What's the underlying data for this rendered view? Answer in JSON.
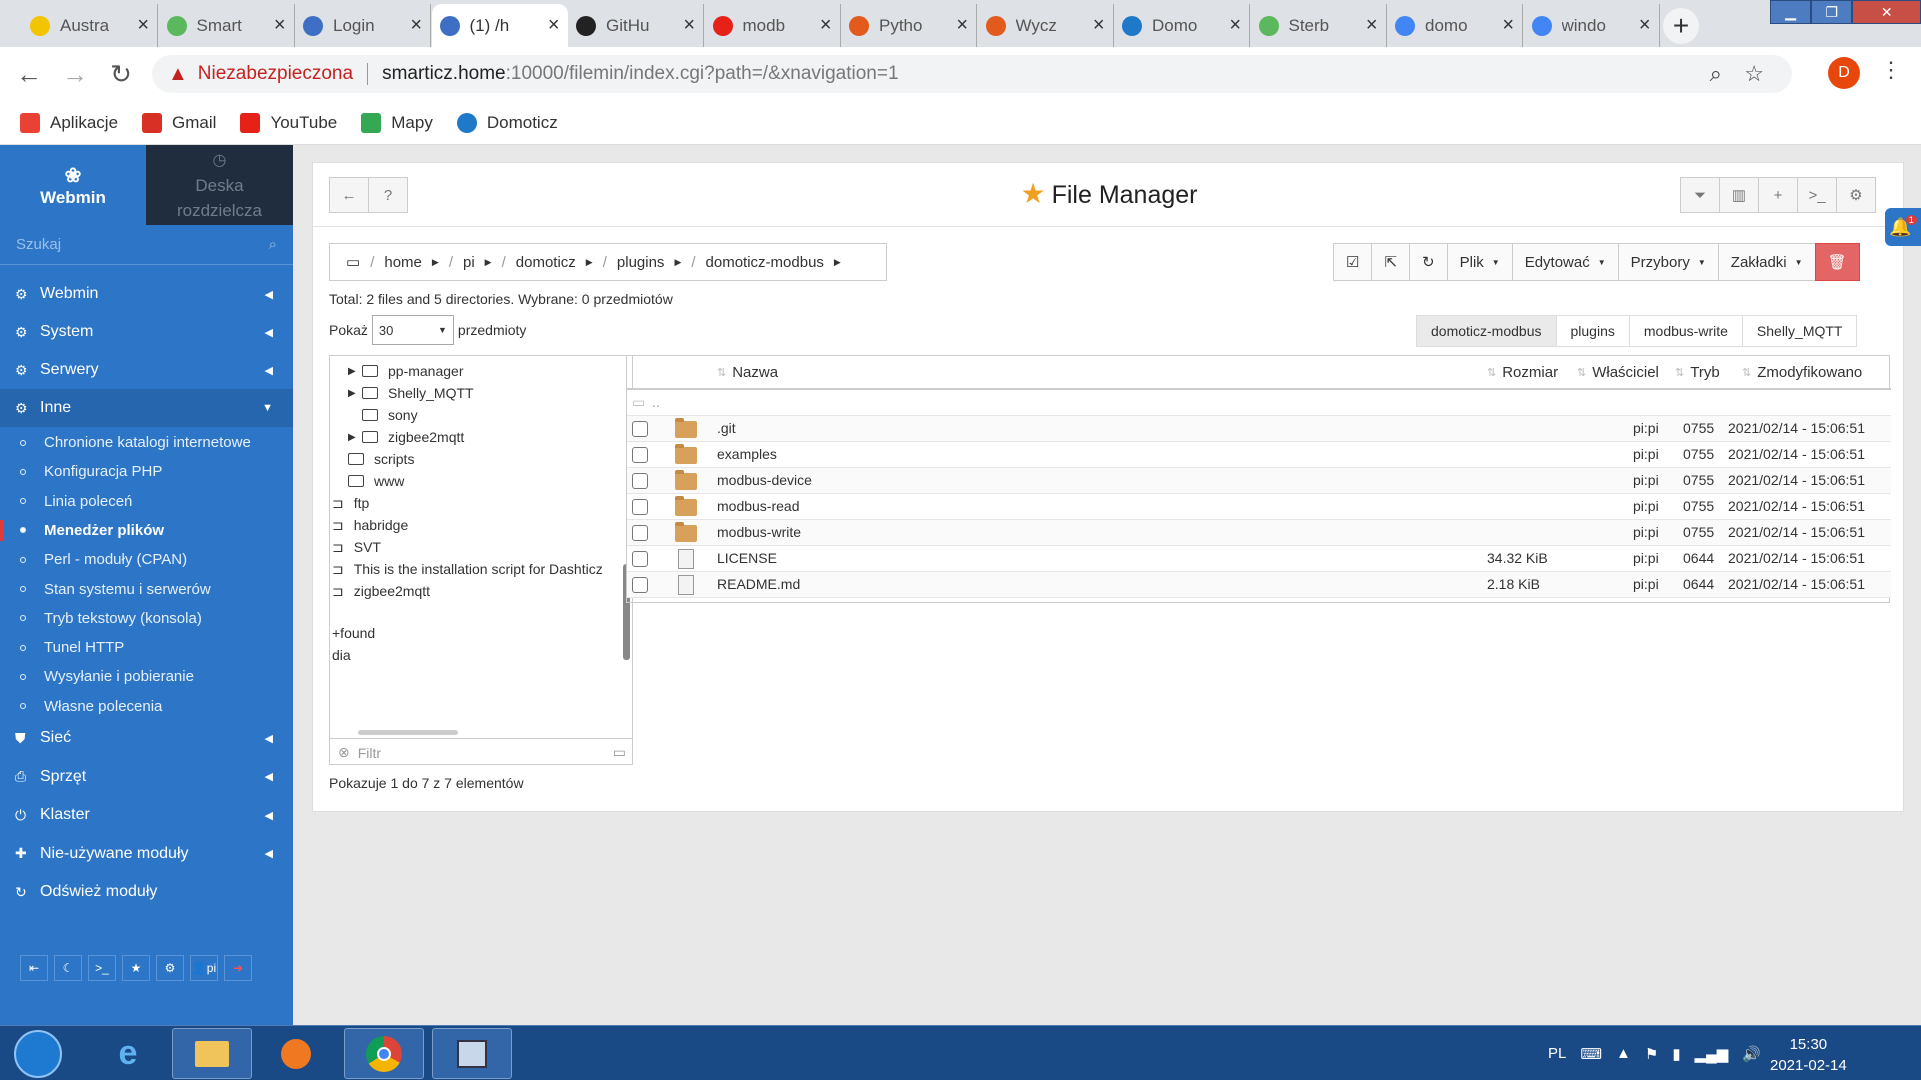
{
  "tabs": [
    {
      "label": "Austra",
      "icon": "sun-icon",
      "color": "#f3c400"
    },
    {
      "label": "Smart",
      "icon": "home-icon",
      "color": "#5cb85c"
    },
    {
      "label": "Login",
      "icon": "webmin-icon",
      "color": "#3f6fc4"
    },
    {
      "label": "(1) /h",
      "icon": "webmin-icon",
      "color": "#3f6fc4"
    },
    {
      "label": "GitHu",
      "icon": "github-icon",
      "color": "#222222"
    },
    {
      "label": "modb",
      "icon": "youtube-icon",
      "color": "#e62117"
    },
    {
      "label": "Pytho",
      "icon": "domoticz-icon",
      "color": "#e25a1c"
    },
    {
      "label": "Wycz",
      "icon": "domoticz-icon",
      "color": "#e25a1c"
    },
    {
      "label": "Domo",
      "icon": "domoticz-icon",
      "color": "#1e79c8"
    },
    {
      "label": "Sterb",
      "icon": "home-icon",
      "color": "#5cb85c"
    },
    {
      "label": "domo",
      "icon": "google-icon",
      "color": "#4285f4"
    },
    {
      "label": "windo",
      "icon": "google-icon",
      "color": "#4285f4"
    }
  ],
  "address": {
    "warning": "Niezabezpieczona",
    "host": "smarticz.home",
    "rest": ":10000/filemin/index.cgi?path=/&xnavigation=1"
  },
  "profile_initial": "D",
  "bookmarks": [
    {
      "label": "Aplikacje",
      "icon": "apps-icon",
      "color": "#e94235"
    },
    {
      "label": "Gmail",
      "icon": "gmail-icon",
      "color": "#d93025"
    },
    {
      "label": "YouTube",
      "icon": "youtube-icon",
      "color": "#e62117"
    },
    {
      "label": "Mapy",
      "icon": "maps-icon",
      "color": "#34a853"
    },
    {
      "label": "Domoticz",
      "icon": "domoticz-icon",
      "color": "#1e79c8"
    }
  ],
  "sidebar": {
    "brand": "Webmin",
    "dashboard": [
      "Deska",
      "rozdzielcza"
    ],
    "search_placeholder": "Szukaj",
    "menu_top": [
      "Webmin",
      "System",
      "Serwery",
      "Inne"
    ],
    "sub": [
      "Chronione katalogi internetowe",
      "Konfiguracja PHP",
      "Linia poleceń",
      "Menedżer plików",
      "Perl - moduły (CPAN)",
      "Stan systemu i serwerów",
      "Tryb tekstowy (konsola)",
      "Tunel HTTP",
      "Wysyłanie i pobieranie",
      "Własne polecenia"
    ],
    "menu_bottom": [
      "Sieć",
      "Sprzęt",
      "Klaster",
      "Nie-używane moduły",
      "Odśwież moduły"
    ],
    "tool_user": "pi"
  },
  "panel": {
    "title": "File Manager",
    "crumbs": [
      "home",
      "pi",
      "domoticz",
      "plugins",
      "domoticz-modbus"
    ],
    "actions": [
      "Plik",
      "Edytować",
      "Przybory",
      "Zakładki"
    ],
    "total": "Total: 2 files and 5 directories. Wybrane: 0 przedmiotów",
    "show_label": "Pokaż",
    "show_value": "30",
    "show_suffix": "przedmioty",
    "quick_tabs": [
      "domoticz-modbus",
      "plugins",
      "modbus-write",
      "Shelly_MQTT"
    ],
    "tree": [
      "pp-manager",
      "Shelly_MQTT",
      "sony",
      "zigbee2mqtt",
      "scripts",
      "www",
      "ftp",
      "habridge",
      "SVT",
      "This is the installation script for Dashticz",
      "zigbee2mqtt",
      "+found",
      "dia"
    ],
    "filter_placeholder": "Filtr",
    "footer": "Pokazuje 1 do 7 z 7 elementów",
    "columns": [
      "Nazwa",
      "Rozmiar",
      "Właściciel",
      "Tryb",
      "Zmodyfikowano"
    ],
    "parent": "..",
    "files": [
      {
        "name": ".git",
        "type": "dir",
        "size": "",
        "owner": "pi:pi",
        "mode": "0755",
        "modified": "2021/02/14 - 15:06:51"
      },
      {
        "name": "examples",
        "type": "dir",
        "size": "",
        "owner": "pi:pi",
        "mode": "0755",
        "modified": "2021/02/14 - 15:06:51"
      },
      {
        "name": "modbus-device",
        "type": "dir",
        "size": "",
        "owner": "pi:pi",
        "mode": "0755",
        "modified": "2021/02/14 - 15:06:51"
      },
      {
        "name": "modbus-read",
        "type": "dir",
        "size": "",
        "owner": "pi:pi",
        "mode": "0755",
        "modified": "2021/02/14 - 15:06:51"
      },
      {
        "name": "modbus-write",
        "type": "dir",
        "size": "",
        "owner": "pi:pi",
        "mode": "0755",
        "modified": "2021/02/14 - 15:06:51"
      },
      {
        "name": "LICENSE",
        "type": "file",
        "size": "34.32 KiB",
        "owner": "pi:pi",
        "mode": "0644",
        "modified": "2021/02/14 - 15:06:51"
      },
      {
        "name": "README.md",
        "type": "file",
        "size": "2.18 KiB",
        "owner": "pi:pi",
        "mode": "0644",
        "modified": "2021/02/14 - 15:06:51"
      }
    ]
  },
  "notification_count": "1",
  "taskbar": {
    "lang": "PL",
    "time": "15:30",
    "date": "2021-02-14"
  }
}
